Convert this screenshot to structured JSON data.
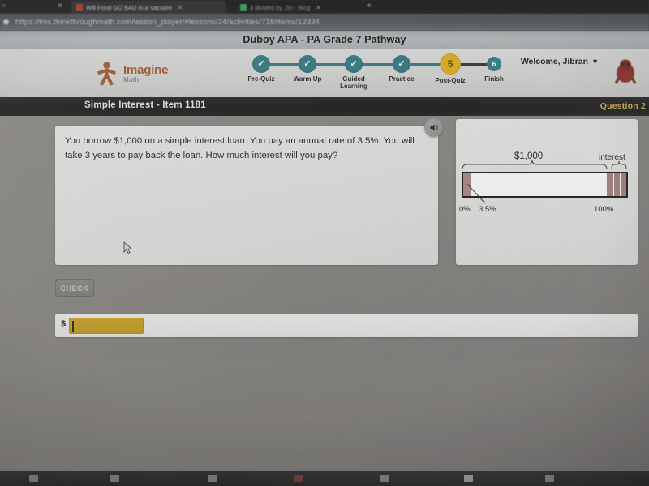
{
  "browser": {
    "left_close_label": "✕",
    "new_tab_label": "+",
    "edge_label": "er",
    "tabs": [
      {
        "title": "Will Food GO BAD in a Vacuum",
        "favicon": "youtube-icon",
        "close_label": "✕",
        "active": true
      },
      {
        "title": "3 divided by .50 - Bing",
        "favicon": "bing-icon",
        "close_label": "✕",
        "active": false
      }
    ],
    "url": "https://lms.thinkthroughmath.com/lesson_player/#lessons/34/activities/718/items/12334"
  },
  "page_title": "Duboy APA - PA Grade 7 Pathway",
  "header": {
    "logo": {
      "brand": "Imagine",
      "sub": "Math",
      "color": "#b4572a"
    },
    "welcome": {
      "text": "Welcome, Jibran",
      "caret": "▼"
    },
    "stepper": {
      "steps": [
        {
          "label": "Pre-Quiz",
          "state": "done",
          "marker": "✓"
        },
        {
          "label": "Warm Up",
          "state": "done",
          "marker": "✓"
        },
        {
          "label": "Guided Learning",
          "state": "done",
          "marker": "✓"
        },
        {
          "label": "Practice",
          "state": "done",
          "marker": "✓"
        },
        {
          "label": "Post-Quiz",
          "state": "active",
          "marker": "5"
        },
        {
          "label": "Finish",
          "state": "future",
          "marker": "6"
        }
      ],
      "done_color": "#2e7f8c",
      "active_color": "#e8b20c"
    }
  },
  "item_bar": {
    "title": "Simple Interest - Item 1181",
    "question_number": "Question 2",
    "accent_color": "#d7b23a"
  },
  "question": {
    "text": "You borrow $1,000 on a simple interest loan. You pay an annual rate of 3.5%. You will take 3 years to pay back the loan. How much interest will you pay?",
    "audio_icon": "speaker-icon"
  },
  "diagram": {
    "principal_label": "$1,000",
    "interest_label": "interest",
    "start_label": "0%",
    "rate_label": "3.5%",
    "end_label": "100%",
    "segment_color": "#b08a86",
    "bar_color": "#ffffff"
  },
  "controls": {
    "check_label": "CHECK",
    "check_enabled": false,
    "currency_symbol": "$",
    "answer_value": "",
    "answer_placeholder": ""
  },
  "taskbar": {
    "icons": [
      "window-icon",
      "folder-icon",
      "browser-icon",
      "chrome-icon",
      "app-icon",
      "display-icon",
      "tray-icon"
    ]
  }
}
